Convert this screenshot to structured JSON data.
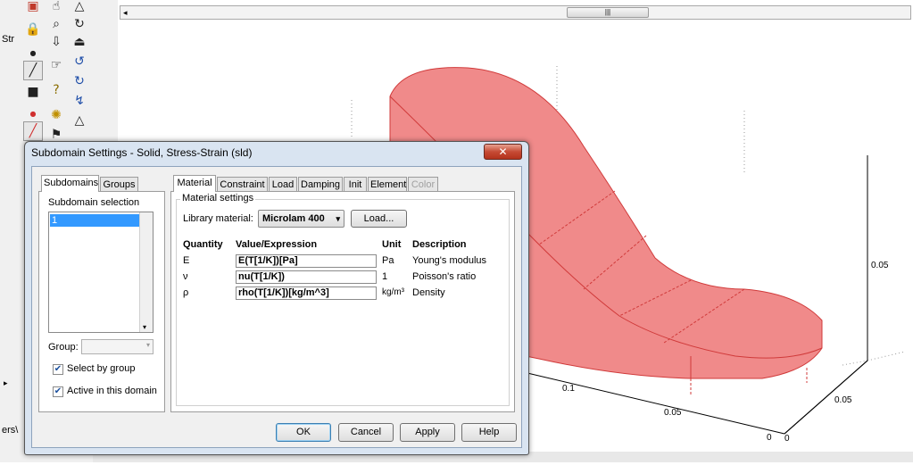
{
  "left_strip": {
    "items": [
      "Str",
      "ers\\"
    ]
  },
  "toolbar": {
    "icons": [
      "save-icon",
      "cursor-icon",
      "triangle-icon",
      "lock-icon",
      "zoom-icon",
      "rotate-icon",
      "point-icon",
      "move-down-icon",
      "eraser-icon",
      "line-icon",
      "select-icon",
      "undo-icon",
      "square-icon",
      "help-icon",
      "redo-icon",
      "point-red-icon",
      "light-icon",
      "spiral-icon",
      "line-red-icon",
      "pin-icon",
      "warning-icon"
    ]
  },
  "plot": {
    "axis_ticks": {
      "right_z": "0.05",
      "x1": "0.1",
      "x2": "0.05",
      "x3": "0",
      "y1": "0.05",
      "y2": "0"
    },
    "solid_color": "#f08a8a"
  },
  "dialog": {
    "title": "Subdomain Settings - Solid, Stress-Strain (sld)",
    "close_label": "✕",
    "left_tabs": [
      "Subdomains",
      "Groups"
    ],
    "subdomain_selection_label": "Subdomain selection",
    "subdomain_items": [
      "1"
    ],
    "group_label": "Group:",
    "group_value": "",
    "select_by_group_label": "Select by group",
    "select_by_group_checked": true,
    "active_in_domain_label": "Active in this domain",
    "active_in_domain_checked": true,
    "right_tabs": [
      "Material",
      "Constraint",
      "Load",
      "Damping",
      "Init",
      "Element",
      "Color"
    ],
    "material_settings_label": "Material settings",
    "library_material_label": "Library material:",
    "library_material_value": "Microlam 400",
    "load_button": "Load...",
    "table_headers": {
      "quantity": "Quantity",
      "value": "Value/Expression",
      "unit": "Unit",
      "description": "Description"
    },
    "rows": [
      {
        "quantity": "E",
        "value": "E(T[1/K])[Pa]",
        "unit": "Pa",
        "description": "Young's modulus"
      },
      {
        "quantity": "ν",
        "value": "nu(T[1/K])",
        "unit": "1",
        "description": "Poisson's ratio"
      },
      {
        "quantity": "ρ",
        "value": "rho(T[1/K])[kg/m^3]",
        "unit": "kg/m³",
        "description": "Density"
      }
    ],
    "buttons": {
      "ok": "OK",
      "cancel": "Cancel",
      "apply": "Apply",
      "help": "Help"
    }
  }
}
